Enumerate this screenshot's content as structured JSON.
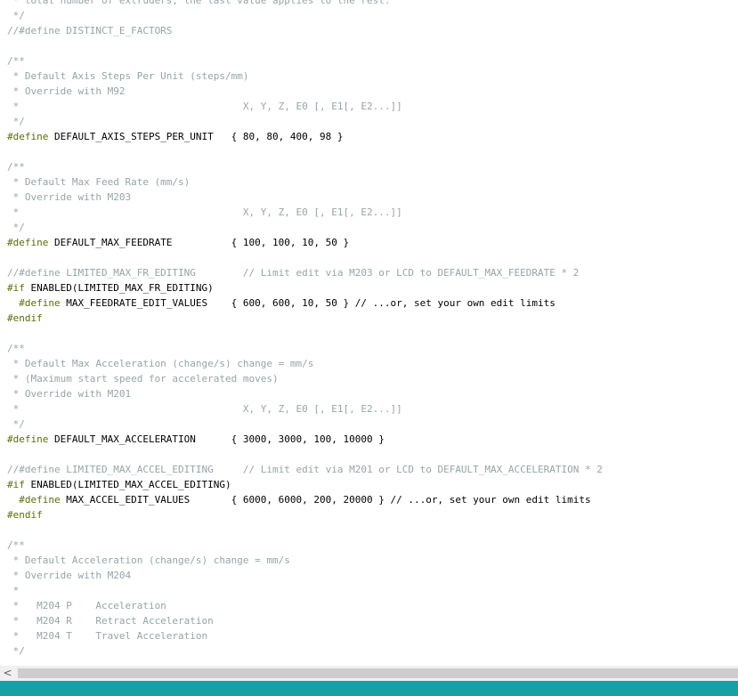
{
  "editor": {
    "lines": [
      {
        "kind": "comment",
        "text": " * total number of extruders, the last value applies to the rest."
      },
      {
        "kind": "comment",
        "text": " */"
      },
      {
        "kind": "comment-define",
        "text": "//#define DISTINCT_E_FACTORS"
      },
      {
        "kind": "blank",
        "text": ""
      },
      {
        "kind": "comment",
        "text": "/**"
      },
      {
        "kind": "comment",
        "text": " * Default Axis Steps Per Unit (steps/mm)"
      },
      {
        "kind": "comment",
        "text": " * Override with M92"
      },
      {
        "kind": "comment",
        "text": " *                                      X, Y, Z, E0 [, E1[, E2...]]"
      },
      {
        "kind": "comment",
        "text": " */"
      },
      {
        "kind": "define",
        "keyword": "#define",
        "rest": " DEFAULT_AXIS_STEPS_PER_UNIT   { 80, 80, 400, 98 }"
      },
      {
        "kind": "blank",
        "text": ""
      },
      {
        "kind": "comment",
        "text": "/**"
      },
      {
        "kind": "comment",
        "text": " * Default Max Feed Rate (mm/s)"
      },
      {
        "kind": "comment",
        "text": " * Override with M203"
      },
      {
        "kind": "comment",
        "text": " *                                      X, Y, Z, E0 [, E1[, E2...]]"
      },
      {
        "kind": "comment",
        "text": " */"
      },
      {
        "kind": "define",
        "keyword": "#define",
        "rest": " DEFAULT_MAX_FEEDRATE          { 100, 100, 10, 50 }"
      },
      {
        "kind": "blank",
        "text": ""
      },
      {
        "kind": "comment-define",
        "text": "//#define LIMITED_MAX_FR_EDITING        // Limit edit via M203 or LCD to DEFAULT_MAX_FEEDRATE * 2"
      },
      {
        "kind": "define",
        "keyword": "#if",
        "rest": " ENABLED(LIMITED_MAX_FR_EDITING)"
      },
      {
        "kind": "define",
        "indent": "  ",
        "keyword": "#define",
        "rest": " MAX_FEEDRATE_EDIT_VALUES    { 600, 600, 10, 50 } // ...or, set your own edit limits"
      },
      {
        "kind": "define",
        "keyword": "#endif",
        "rest": ""
      },
      {
        "kind": "blank",
        "text": ""
      },
      {
        "kind": "comment",
        "text": "/**"
      },
      {
        "kind": "comment",
        "text": " * Default Max Acceleration (change/s) change = mm/s"
      },
      {
        "kind": "comment",
        "text": " * (Maximum start speed for accelerated moves)"
      },
      {
        "kind": "comment",
        "text": " * Override with M201"
      },
      {
        "kind": "comment",
        "text": " *                                      X, Y, Z, E0 [, E1[, E2...]]"
      },
      {
        "kind": "comment",
        "text": " */"
      },
      {
        "kind": "define",
        "keyword": "#define",
        "rest": " DEFAULT_MAX_ACCELERATION      { 3000, 3000, 100, 10000 }"
      },
      {
        "kind": "blank",
        "text": ""
      },
      {
        "kind": "comment-define",
        "text": "//#define LIMITED_MAX_ACCEL_EDITING     // Limit edit via M201 or LCD to DEFAULT_MAX_ACCELERATION * 2"
      },
      {
        "kind": "define",
        "keyword": "#if",
        "rest": " ENABLED(LIMITED_MAX_ACCEL_EDITING)"
      },
      {
        "kind": "define",
        "indent": "  ",
        "keyword": "#define",
        "rest": " MAX_ACCEL_EDIT_VALUES       { 6000, 6000, 200, 20000 } // ...or, set your own edit limits"
      },
      {
        "kind": "define",
        "keyword": "#endif",
        "rest": ""
      },
      {
        "kind": "blank",
        "text": ""
      },
      {
        "kind": "comment",
        "text": "/**"
      },
      {
        "kind": "comment",
        "text": " * Default Acceleration (change/s) change = mm/s"
      },
      {
        "kind": "comment",
        "text": " * Override with M204"
      },
      {
        "kind": "comment",
        "text": " *"
      },
      {
        "kind": "comment",
        "text": " *   M204 P    Acceleration"
      },
      {
        "kind": "comment",
        "text": " *   M204 R    Retract Acceleration"
      },
      {
        "kind": "comment",
        "text": " *   M204 T    Travel Acceleration"
      },
      {
        "kind": "comment",
        "text": " */"
      }
    ]
  },
  "scrollbar": {
    "left_arrow": "<"
  },
  "colors": {
    "comment": "#95a5a6",
    "preprocessor": "#5e6d03",
    "text": "#000000",
    "statusbar": "#17a1a5"
  }
}
